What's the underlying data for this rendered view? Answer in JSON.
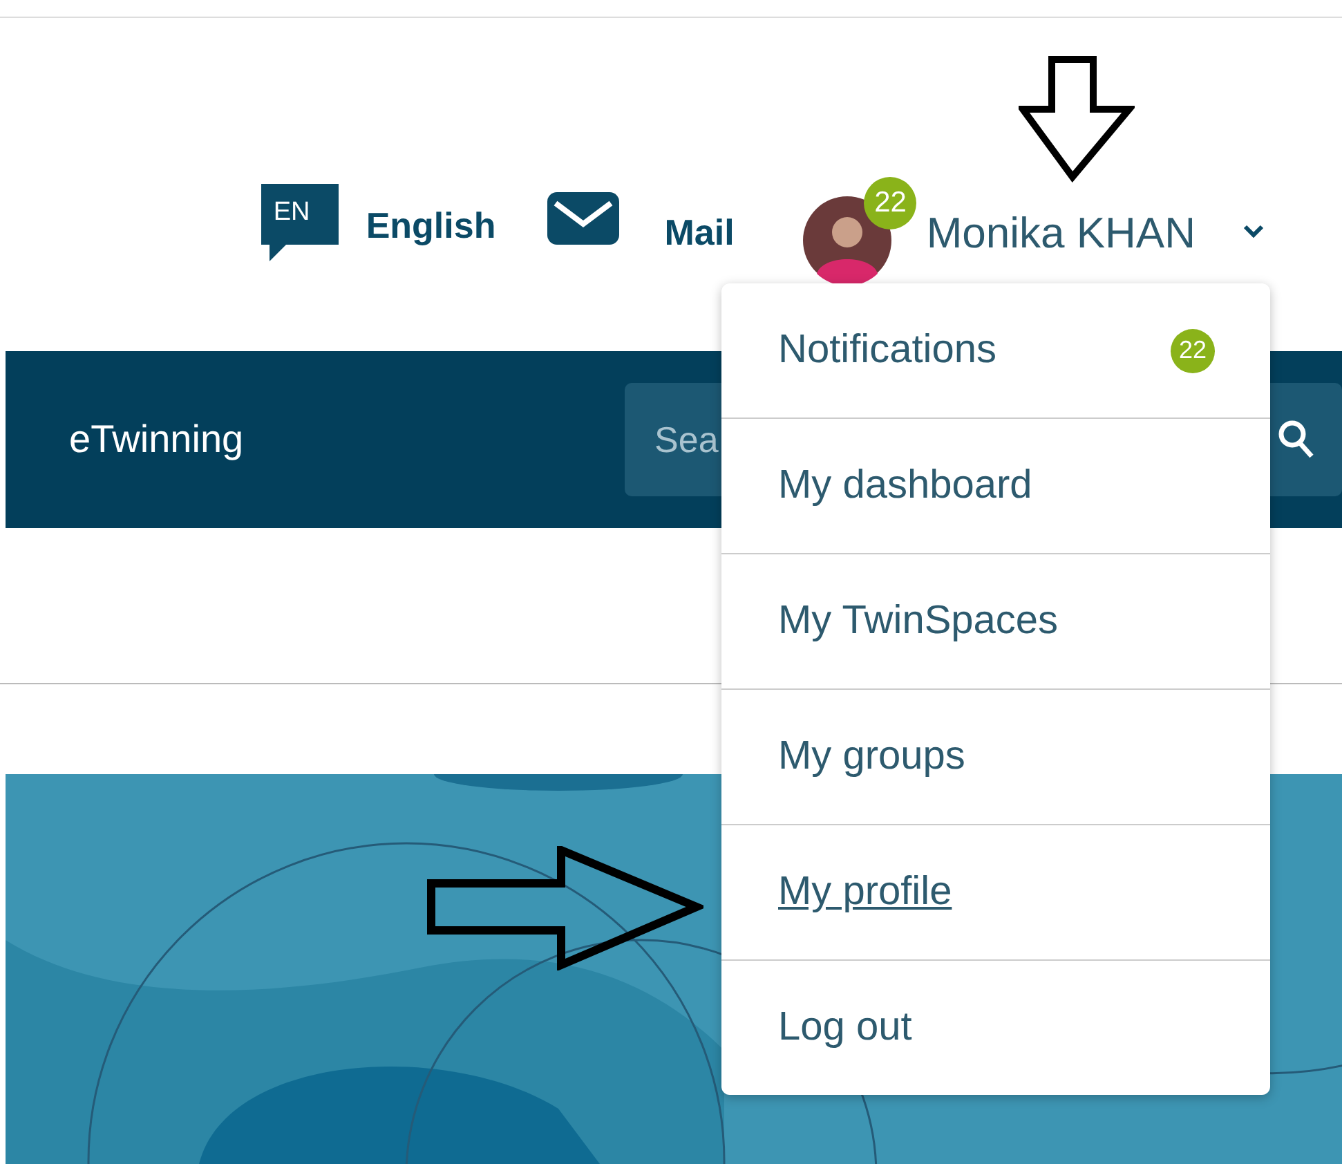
{
  "header": {
    "language_code": "EN",
    "language": "English",
    "mail": "Mail",
    "user": {
      "name": "Monika KHAN",
      "badge": "22"
    }
  },
  "navbar": {
    "title": "eTwinning",
    "search": {
      "placeholder": "Sea"
    }
  },
  "user_menu": {
    "expanded": true,
    "items": [
      {
        "label": "Notifications",
        "badge": "22",
        "selected": false
      },
      {
        "label": "My dashboard",
        "selected": false
      },
      {
        "label": "My TwinSpaces",
        "selected": false
      },
      {
        "label": "My groups",
        "selected": false
      },
      {
        "label": "My profile",
        "selected": true
      },
      {
        "label": "Log out",
        "selected": false
      }
    ]
  }
}
